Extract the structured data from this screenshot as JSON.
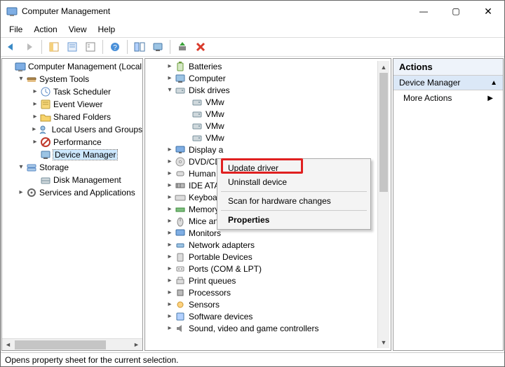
{
  "window": {
    "title": "Computer Management"
  },
  "menu": [
    "File",
    "Action",
    "View",
    "Help"
  ],
  "status": "Opens property sheet for the current selection.",
  "left_tree": [
    {
      "indent": "indent1",
      "twisty": "none",
      "icon": "#mgmt",
      "label": "Computer Management (Local"
    },
    {
      "indent": "indent2",
      "twisty": "open",
      "icon": "#tools",
      "label": "System Tools"
    },
    {
      "indent": "indent3",
      "twisty": "closed",
      "icon": "#sched",
      "label": "Task Scheduler"
    },
    {
      "indent": "indent3",
      "twisty": "closed",
      "icon": "#event",
      "label": "Event Viewer"
    },
    {
      "indent": "indent3",
      "twisty": "closed",
      "icon": "#shared",
      "label": "Shared Folders"
    },
    {
      "indent": "indent3",
      "twisty": "closed",
      "icon": "#users",
      "label": "Local Users and Groups"
    },
    {
      "indent": "indent3",
      "twisty": "closed",
      "icon": "#perf",
      "label": "Performance"
    },
    {
      "indent": "indent3",
      "twisty": "none",
      "icon": "#devmgr",
      "label": "Device Manager",
      "selected": true
    },
    {
      "indent": "indent2",
      "twisty": "open",
      "icon": "#storage",
      "label": "Storage"
    },
    {
      "indent": "indent3",
      "twisty": "none",
      "icon": "#diskmg",
      "label": "Disk Management"
    },
    {
      "indent": "indent2",
      "twisty": "closed",
      "icon": "#services",
      "label": "Services and Applications"
    }
  ],
  "dev_list": [
    {
      "indent": "d2",
      "twisty": "closed",
      "icon": "#batt",
      "label": "Batteries"
    },
    {
      "indent": "d2",
      "twisty": "closed",
      "icon": "#pc",
      "label": "Computer"
    },
    {
      "indent": "d2",
      "twisty": "open",
      "icon": "#disk",
      "label": "Disk drives"
    },
    {
      "indent": "d3",
      "twisty": "none",
      "icon": "#disk",
      "label": "VMw"
    },
    {
      "indent": "d3",
      "twisty": "none",
      "icon": "#disk",
      "label": "VMw"
    },
    {
      "indent": "d3",
      "twisty": "none",
      "icon": "#disk",
      "label": "VMw"
    },
    {
      "indent": "d3",
      "twisty": "none",
      "icon": "#disk",
      "label": "VMw"
    },
    {
      "indent": "d2",
      "twisty": "closed",
      "icon": "#disp",
      "label": "Display a"
    },
    {
      "indent": "d2",
      "twisty": "closed",
      "icon": "#dvd",
      "label": "DVD/CD"
    },
    {
      "indent": "d2",
      "twisty": "closed",
      "icon": "#hid",
      "label": "Human Interface Devices"
    },
    {
      "indent": "d2",
      "twisty": "closed",
      "icon": "#ide",
      "label": "IDE ATA/ATAPI controllers"
    },
    {
      "indent": "d2",
      "twisty": "closed",
      "icon": "#kbd",
      "label": "Keyboards"
    },
    {
      "indent": "d2",
      "twisty": "closed",
      "icon": "#mem",
      "label": "Memory devices"
    },
    {
      "indent": "d2",
      "twisty": "closed",
      "icon": "#mouse",
      "label": "Mice and other pointing devices"
    },
    {
      "indent": "d2",
      "twisty": "closed",
      "icon": "#mon",
      "label": "Monitors"
    },
    {
      "indent": "d2",
      "twisty": "closed",
      "icon": "#net",
      "label": "Network adapters"
    },
    {
      "indent": "d2",
      "twisty": "closed",
      "icon": "#port",
      "label": "Portable Devices"
    },
    {
      "indent": "d2",
      "twisty": "closed",
      "icon": "#com",
      "label": "Ports (COM & LPT)"
    },
    {
      "indent": "d2",
      "twisty": "closed",
      "icon": "#print",
      "label": "Print queues"
    },
    {
      "indent": "d2",
      "twisty": "closed",
      "icon": "#cpu",
      "label": "Processors"
    },
    {
      "indent": "d2",
      "twisty": "closed",
      "icon": "#sensor",
      "label": "Sensors"
    },
    {
      "indent": "d2",
      "twisty": "closed",
      "icon": "#soft",
      "label": "Software devices"
    },
    {
      "indent": "d2",
      "twisty": "closed",
      "icon": "#sound",
      "label": "Sound, video and game controllers"
    }
  ],
  "context_menu": [
    {
      "label": "Update driver",
      "type": "item"
    },
    {
      "label": "Uninstall device",
      "type": "item"
    },
    {
      "type": "sep"
    },
    {
      "label": "Scan for hardware changes",
      "type": "item"
    },
    {
      "type": "sep"
    },
    {
      "label": "Properties",
      "type": "item",
      "bold": true
    }
  ],
  "actions": {
    "header": "Actions",
    "sub": "Device Manager",
    "more": "More Actions"
  }
}
